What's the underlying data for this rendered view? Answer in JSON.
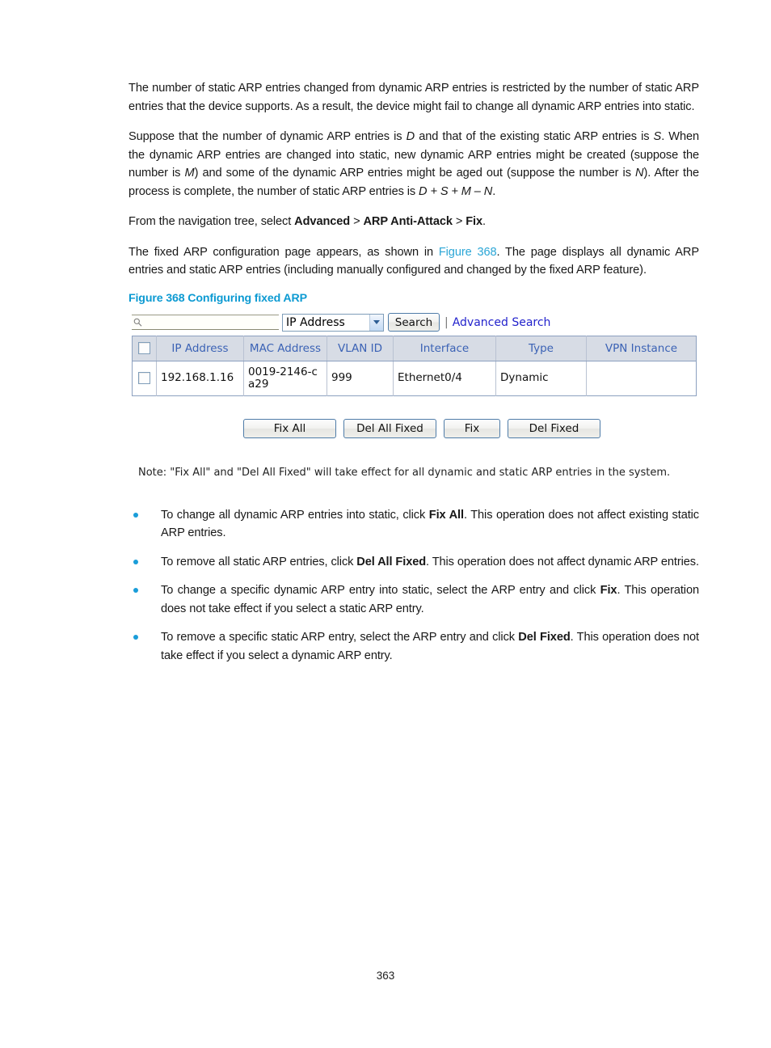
{
  "document": {
    "page_number": "363",
    "paragraphs": [
      {
        "id": "p1",
        "runs": [
          {
            "t": "The number of static ARP entries changed from dynamic ARP entries is restricted by the number of static ARP entries that the device supports. As a result, the device might fail to change all dynamic ARP entries into static.",
            "s": "n"
          }
        ]
      },
      {
        "id": "p2",
        "runs": [
          {
            "t": "Suppose that the number of dynamic ARP entries is ",
            "s": "n"
          },
          {
            "t": "D",
            "s": "i"
          },
          {
            "t": " and that of the existing static ARP entries is ",
            "s": "n"
          },
          {
            "t": "S",
            "s": "i"
          },
          {
            "t": ". When the dynamic ARP entries are changed into static, new dynamic ARP entries might be created (suppose the number is ",
            "s": "n"
          },
          {
            "t": "M",
            "s": "i"
          },
          {
            "t": ") and some of the dynamic ARP entries might be aged out (suppose the number is ",
            "s": "n"
          },
          {
            "t": "N",
            "s": "i"
          },
          {
            "t": "). After the process is complete, the number of static ARP entries is ",
            "s": "n"
          },
          {
            "t": "D + S + M – N",
            "s": "i"
          },
          {
            "t": ".",
            "s": "n"
          }
        ]
      },
      {
        "id": "p3",
        "runs": [
          {
            "t": "From the navigation tree, select ",
            "s": "n"
          },
          {
            "t": "Advanced",
            "s": "b"
          },
          {
            "t": " > ",
            "s": "n"
          },
          {
            "t": "ARP Anti-Attack",
            "s": "b"
          },
          {
            "t": " > ",
            "s": "n"
          },
          {
            "t": "Fix",
            "s": "b"
          },
          {
            "t": ".",
            "s": "n"
          }
        ]
      },
      {
        "id": "p4",
        "runs": [
          {
            "t": "The fixed ARP configuration page appears, as shown in ",
            "s": "n"
          },
          {
            "t": "Figure 368",
            "s": "l"
          },
          {
            "t": ". The page displays all dynamic ARP entries and static ARP entries (including manually configured and changed by the fixed ARP feature).",
            "s": "n"
          }
        ]
      }
    ],
    "figure_caption": "Figure 368 Configuring fixed ARP",
    "bullets": [
      {
        "runs": [
          {
            "t": "To change all dynamic ARP entries into static, click ",
            "s": "n"
          },
          {
            "t": "Fix All",
            "s": "b"
          },
          {
            "t": ". This operation does not affect existing static ARP entries.",
            "s": "n"
          }
        ]
      },
      {
        "runs": [
          {
            "t": "To remove all static ARP entries, click ",
            "s": "n"
          },
          {
            "t": "Del All Fixed",
            "s": "b"
          },
          {
            "t": ". This operation does not affect dynamic ARP entries.",
            "s": "n"
          }
        ]
      },
      {
        "runs": [
          {
            "t": "To change a specific dynamic ARP entry into static, select the ARP entry and click ",
            "s": "n"
          },
          {
            "t": "Fix",
            "s": "b"
          },
          {
            "t": ". This operation does not take effect if you select a static ARP entry.",
            "s": "n"
          }
        ]
      },
      {
        "runs": [
          {
            "t": "To remove a specific static ARP entry, select the ARP entry and click ",
            "s": "n"
          },
          {
            "t": "Del Fixed",
            "s": "b"
          },
          {
            "t": ". This operation does not take effect if you select a dynamic ARP entry.",
            "s": "n"
          }
        ]
      }
    ]
  },
  "screenshot": {
    "search": {
      "query_value": "",
      "placeholder": "",
      "icon": "magnifier-icon",
      "field_selected": "IP Address",
      "field_options": [
        "IP Address"
      ],
      "search_button": "Search",
      "separator": "|",
      "advanced_search_link": "Advanced Search"
    },
    "table": {
      "columns": [
        "",
        "IP Address",
        "MAC Address",
        "VLAN ID",
        "Interface",
        "Type",
        "VPN Instance"
      ],
      "rows": [
        {
          "selected": false,
          "ip_address": "192.168.1.16",
          "mac_address": "0019-2146-ca29",
          "vlan_id": "999",
          "interface": "Ethernet0/4",
          "type": "Dynamic",
          "vpn_instance": ""
        }
      ]
    },
    "buttons": {
      "fix_all": "Fix All",
      "del_all_fixed": "Del All Fixed",
      "fix": "Fix",
      "del_fixed": "Del Fixed"
    },
    "note": "Note: \"Fix All\" and \"Del All Fixed\" will take effect for all dynamic and static ARP entries in the system."
  },
  "colors": {
    "figure_caption": "#0c9ad2",
    "link": "#2222cc",
    "cross_ref": "#2ba6d6",
    "table_header_bg": "#d7dce5",
    "table_header_text": "#3b62b5",
    "bullet": "#1a9dd9",
    "button_border": "#4f7ca8"
  }
}
